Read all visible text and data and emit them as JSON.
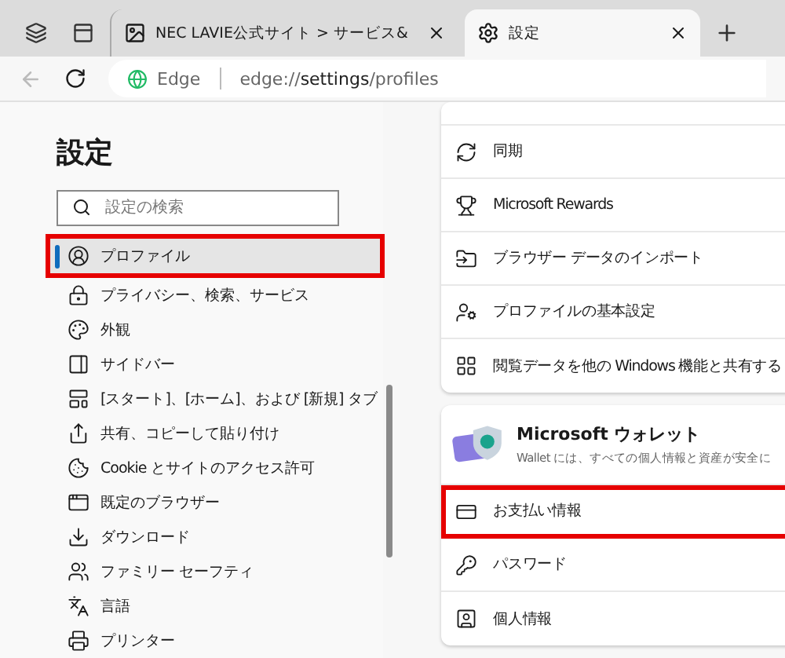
{
  "tabs": [
    {
      "title": "NEC LAVIE公式サイト > サービス&",
      "selected": false,
      "kind": "page"
    },
    {
      "title": "設定",
      "selected": true,
      "kind": "settings"
    }
  ],
  "address_bar": {
    "site_label": "Edge",
    "url_prefix": "edge://",
    "url_bold": "settings",
    "url_suffix": "/profiles"
  },
  "sidebar": {
    "title": "設定",
    "search": {
      "placeholder": "設定の検索"
    },
    "items": [
      {
        "label": "プロファイル",
        "selected": true,
        "highlighted": true
      },
      {
        "label": "プライバシー、検索、サービス",
        "selected": false,
        "highlighted": false
      },
      {
        "label": "外観",
        "selected": false,
        "highlighted": false
      },
      {
        "label": "サイドバー",
        "selected": false,
        "highlighted": false
      },
      {
        "label": "[スタート]、[ホーム]、および [新規] タブ",
        "selected": false,
        "highlighted": false
      },
      {
        "label": "共有、コピーして貼り付け",
        "selected": false,
        "highlighted": false
      },
      {
        "label": "Cookie とサイトのアクセス許可",
        "selected": false,
        "highlighted": false
      },
      {
        "label": "既定のブラウザー",
        "selected": false,
        "highlighted": false
      },
      {
        "label": "ダウンロード",
        "selected": false,
        "highlighted": false
      },
      {
        "label": "ファミリー セーフティ",
        "selected": false,
        "highlighted": false
      },
      {
        "label": "言語",
        "selected": false,
        "highlighted": false
      },
      {
        "label": "プリンター",
        "selected": false,
        "highlighted": false
      }
    ]
  },
  "profile_card": {
    "rows": [
      {
        "label": "同期",
        "highlighted": false
      },
      {
        "label": "Microsoft Rewards",
        "highlighted": false
      },
      {
        "label": "ブラウザー データのインポート",
        "highlighted": false
      },
      {
        "label": "プロファイルの基本設定",
        "highlighted": false
      },
      {
        "label": "閲覧データを他の Windows 機能と共有する",
        "highlighted": false
      }
    ]
  },
  "wallet_card": {
    "title": "Microsoft ウォレット",
    "description": "Wallet には、すべての個人情報と資産が安全に",
    "rows": [
      {
        "label": "お支払い情報",
        "highlighted": true
      },
      {
        "label": "パスワード",
        "highlighted": false
      },
      {
        "label": "個人情報",
        "highlighted": false
      }
    ]
  }
}
